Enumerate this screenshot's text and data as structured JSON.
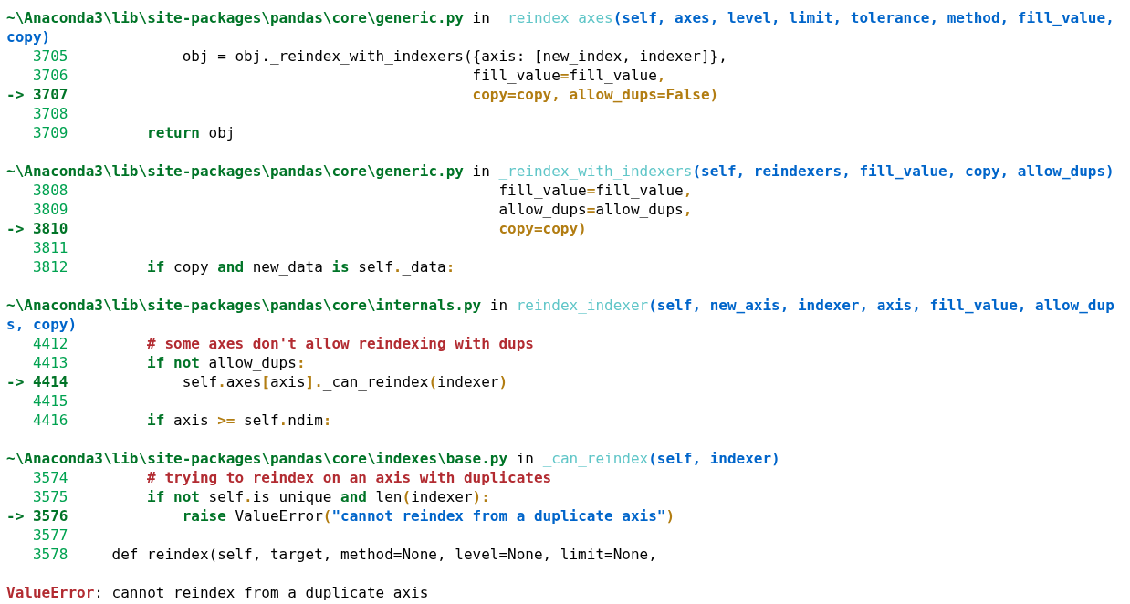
{
  "frames": [
    {
      "path": "~\\Anaconda3\\lib\\site-packages\\pandas\\core\\generic.py",
      "in": "in",
      "func": "_reindex_axes",
      "args": "(self, axes, level, limit, tolerance, method, fill_value, copy)",
      "lines": [
        {
          "number": "3705",
          "current": false,
          "kind": "nested",
          "tokens": [
            {
              "kind": "plain",
              "text": "obj = obj._reindex_with_indexers({axis: [new_index, indexer]},"
            }
          ]
        },
        {
          "number": "3706",
          "current": false,
          "kind": "continuation",
          "tokens": [
            {
              "kind": "plain",
              "text": "fill_value"
            },
            {
              "kind": "op",
              "text": "="
            },
            {
              "kind": "plain",
              "text": "fill_value"
            },
            {
              "kind": "op",
              "text": ","
            }
          ]
        },
        {
          "marker": "->",
          "number": "3707",
          "current": true,
          "kind": "continuation",
          "tokens": [
            {
              "kind": "op",
              "text": "copy=copy, allow_dups=False)"
            }
          ]
        },
        {
          "number": "3708",
          "current": false
        },
        {
          "number": "3709",
          "current": false,
          "kind": "body",
          "tokens": [
            {
              "kind": "kw",
              "text": "return"
            },
            {
              "kind": "plain",
              "text": " obj"
            }
          ]
        }
      ]
    },
    {
      "path": "~\\Anaconda3\\lib\\site-packages\\pandas\\core\\generic.py",
      "in": "in",
      "func": "_reindex_with_indexers",
      "args": "(self, reindexers, fill_value, copy, allow_dups)",
      "lines": [
        {
          "number": "3808",
          "current": false,
          "kind": "deep",
          "tokens": [
            {
              "kind": "plain",
              "text": "fill_value"
            },
            {
              "kind": "op",
              "text": "="
            },
            {
              "kind": "plain",
              "text": "fill_value"
            },
            {
              "kind": "op",
              "text": ","
            }
          ]
        },
        {
          "number": "3809",
          "current": false,
          "kind": "deep",
          "tokens": [
            {
              "kind": "plain",
              "text": "allow_dups"
            },
            {
              "kind": "op",
              "text": "="
            },
            {
              "kind": "plain",
              "text": "allow_dups"
            },
            {
              "kind": "op",
              "text": ","
            }
          ]
        },
        {
          "marker": "->",
          "number": "3810",
          "current": true,
          "kind": "deep",
          "tokens": [
            {
              "kind": "op",
              "text": "copy=copy)"
            }
          ]
        },
        {
          "number": "3811",
          "current": false
        },
        {
          "number": "3812",
          "current": false,
          "kind": "body",
          "tokens": [
            {
              "kind": "kw",
              "text": "if"
            },
            {
              "kind": "plain",
              "text": " copy "
            },
            {
              "kind": "kw",
              "text": "and"
            },
            {
              "kind": "plain",
              "text": " new_data "
            },
            {
              "kind": "kw",
              "text": "is"
            },
            {
              "kind": "plain",
              "text": " self"
            },
            {
              "kind": "op",
              "text": "."
            },
            {
              "kind": "plain",
              "text": "_data"
            },
            {
              "kind": "op",
              "text": ":"
            }
          ]
        }
      ]
    },
    {
      "path": "~\\Anaconda3\\lib\\site-packages\\pandas\\core\\internals.py",
      "in": "in",
      "func": "reindex_indexer",
      "args": "(self, new_axis, indexer, axis, fill_value, allow_dups, copy)",
      "lines": [
        {
          "number": "4412",
          "current": false,
          "kind": "body",
          "tokens": [
            {
              "kind": "comment",
              "text": "# some axes don't allow reindexing with dups"
            }
          ]
        },
        {
          "number": "4413",
          "current": false,
          "kind": "body",
          "tokens": [
            {
              "kind": "kw",
              "text": "if not"
            },
            {
              "kind": "plain",
              "text": " allow_dups"
            },
            {
              "kind": "op",
              "text": ":"
            }
          ]
        },
        {
          "marker": "->",
          "number": "4414",
          "current": true,
          "kind": "nested",
          "tokens": [
            {
              "kind": "plain",
              "text": "self"
            },
            {
              "kind": "op",
              "text": "."
            },
            {
              "kind": "plain",
              "text": "axes"
            },
            {
              "kind": "op",
              "text": "["
            },
            {
              "kind": "plain",
              "text": "axis"
            },
            {
              "kind": "op",
              "text": "]."
            },
            {
              "kind": "plain",
              "text": "_can_reindex"
            },
            {
              "kind": "op",
              "text": "("
            },
            {
              "kind": "plain",
              "text": "indexer"
            },
            {
              "kind": "op",
              "text": ")"
            }
          ]
        },
        {
          "number": "4415",
          "current": false
        },
        {
          "number": "4416",
          "current": false,
          "kind": "body",
          "tokens": [
            {
              "kind": "kw",
              "text": "if"
            },
            {
              "kind": "plain",
              "text": " axis "
            },
            {
              "kind": "op",
              "text": ">="
            },
            {
              "kind": "plain",
              "text": " self"
            },
            {
              "kind": "op",
              "text": "."
            },
            {
              "kind": "plain",
              "text": "ndim"
            },
            {
              "kind": "op",
              "text": ":"
            }
          ]
        }
      ]
    },
    {
      "path": "~\\Anaconda3\\lib\\site-packages\\pandas\\core\\indexes\\base.py",
      "in": "in",
      "func": "_can_reindex",
      "args": "(self, indexer)",
      "lines": [
        {
          "number": "3574",
          "current": false,
          "kind": "body",
          "tokens": [
            {
              "kind": "comment",
              "text": "# trying to reindex on an axis with duplicates"
            }
          ]
        },
        {
          "number": "3575",
          "current": false,
          "kind": "body",
          "tokens": [
            {
              "kind": "kw",
              "text": "if not"
            },
            {
              "kind": "plain",
              "text": " self"
            },
            {
              "kind": "op",
              "text": "."
            },
            {
              "kind": "plain",
              "text": "is_unique "
            },
            {
              "kind": "kw",
              "text": "and"
            },
            {
              "kind": "plain",
              "text": " len"
            },
            {
              "kind": "op",
              "text": "("
            },
            {
              "kind": "plain",
              "text": "indexer"
            },
            {
              "kind": "op",
              "text": "):"
            }
          ]
        },
        {
          "marker": "->",
          "number": "3576",
          "current": true,
          "kind": "nested",
          "tokens": [
            {
              "kind": "kw",
              "text": "raise"
            },
            {
              "kind": "plain",
              "text": " ValueError"
            },
            {
              "kind": "op",
              "text": "("
            },
            {
              "kind": "str",
              "text": "\"cannot reindex from a duplicate axis\""
            },
            {
              "kind": "op",
              "text": ")"
            }
          ]
        },
        {
          "number": "3577",
          "current": false
        },
        {
          "number": "3578",
          "current": false,
          "kind": "def",
          "tokens": [
            {
              "kind": "plain",
              "text": "def reindex(self, target, method=None, level=None, limit=None,"
            }
          ]
        }
      ]
    }
  ],
  "error": {
    "name": "ValueError",
    "message": ": cannot reindex from a duplicate axis"
  }
}
